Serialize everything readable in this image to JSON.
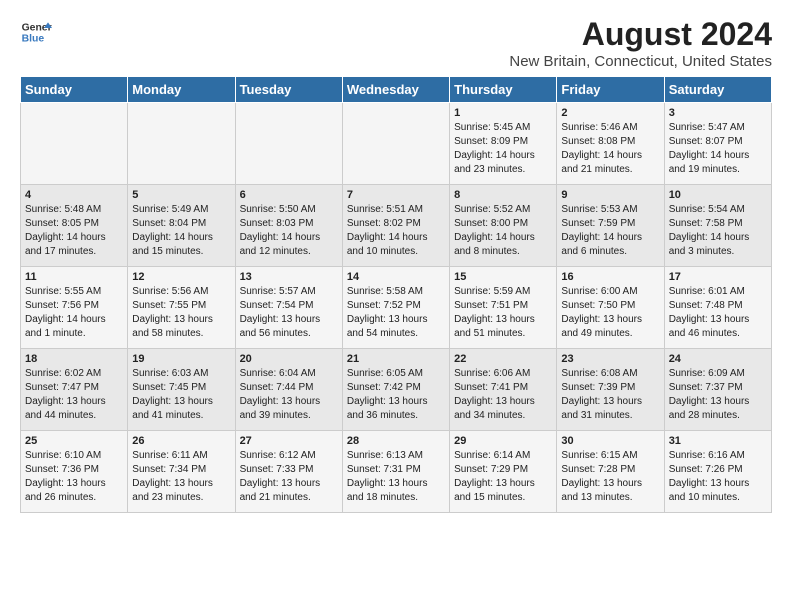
{
  "logo": {
    "line1": "General",
    "line2": "Blue"
  },
  "title": "August 2024",
  "subtitle": "New Britain, Connecticut, United States",
  "headers": [
    "Sunday",
    "Monday",
    "Tuesday",
    "Wednesday",
    "Thursday",
    "Friday",
    "Saturday"
  ],
  "weeks": [
    [
      {
        "day": "",
        "info": ""
      },
      {
        "day": "",
        "info": ""
      },
      {
        "day": "",
        "info": ""
      },
      {
        "day": "",
        "info": ""
      },
      {
        "day": "1",
        "info": "Sunrise: 5:45 AM\nSunset: 8:09 PM\nDaylight: 14 hours\nand 23 minutes."
      },
      {
        "day": "2",
        "info": "Sunrise: 5:46 AM\nSunset: 8:08 PM\nDaylight: 14 hours\nand 21 minutes."
      },
      {
        "day": "3",
        "info": "Sunrise: 5:47 AM\nSunset: 8:07 PM\nDaylight: 14 hours\nand 19 minutes."
      }
    ],
    [
      {
        "day": "4",
        "info": "Sunrise: 5:48 AM\nSunset: 8:05 PM\nDaylight: 14 hours\nand 17 minutes."
      },
      {
        "day": "5",
        "info": "Sunrise: 5:49 AM\nSunset: 8:04 PM\nDaylight: 14 hours\nand 15 minutes."
      },
      {
        "day": "6",
        "info": "Sunrise: 5:50 AM\nSunset: 8:03 PM\nDaylight: 14 hours\nand 12 minutes."
      },
      {
        "day": "7",
        "info": "Sunrise: 5:51 AM\nSunset: 8:02 PM\nDaylight: 14 hours\nand 10 minutes."
      },
      {
        "day": "8",
        "info": "Sunrise: 5:52 AM\nSunset: 8:00 PM\nDaylight: 14 hours\nand 8 minutes."
      },
      {
        "day": "9",
        "info": "Sunrise: 5:53 AM\nSunset: 7:59 PM\nDaylight: 14 hours\nand 6 minutes."
      },
      {
        "day": "10",
        "info": "Sunrise: 5:54 AM\nSunset: 7:58 PM\nDaylight: 14 hours\nand 3 minutes."
      }
    ],
    [
      {
        "day": "11",
        "info": "Sunrise: 5:55 AM\nSunset: 7:56 PM\nDaylight: 14 hours\nand 1 minute."
      },
      {
        "day": "12",
        "info": "Sunrise: 5:56 AM\nSunset: 7:55 PM\nDaylight: 13 hours\nand 58 minutes."
      },
      {
        "day": "13",
        "info": "Sunrise: 5:57 AM\nSunset: 7:54 PM\nDaylight: 13 hours\nand 56 minutes."
      },
      {
        "day": "14",
        "info": "Sunrise: 5:58 AM\nSunset: 7:52 PM\nDaylight: 13 hours\nand 54 minutes."
      },
      {
        "day": "15",
        "info": "Sunrise: 5:59 AM\nSunset: 7:51 PM\nDaylight: 13 hours\nand 51 minutes."
      },
      {
        "day": "16",
        "info": "Sunrise: 6:00 AM\nSunset: 7:50 PM\nDaylight: 13 hours\nand 49 minutes."
      },
      {
        "day": "17",
        "info": "Sunrise: 6:01 AM\nSunset: 7:48 PM\nDaylight: 13 hours\nand 46 minutes."
      }
    ],
    [
      {
        "day": "18",
        "info": "Sunrise: 6:02 AM\nSunset: 7:47 PM\nDaylight: 13 hours\nand 44 minutes."
      },
      {
        "day": "19",
        "info": "Sunrise: 6:03 AM\nSunset: 7:45 PM\nDaylight: 13 hours\nand 41 minutes."
      },
      {
        "day": "20",
        "info": "Sunrise: 6:04 AM\nSunset: 7:44 PM\nDaylight: 13 hours\nand 39 minutes."
      },
      {
        "day": "21",
        "info": "Sunrise: 6:05 AM\nSunset: 7:42 PM\nDaylight: 13 hours\nand 36 minutes."
      },
      {
        "day": "22",
        "info": "Sunrise: 6:06 AM\nSunset: 7:41 PM\nDaylight: 13 hours\nand 34 minutes."
      },
      {
        "day": "23",
        "info": "Sunrise: 6:08 AM\nSunset: 7:39 PM\nDaylight: 13 hours\nand 31 minutes."
      },
      {
        "day": "24",
        "info": "Sunrise: 6:09 AM\nSunset: 7:37 PM\nDaylight: 13 hours\nand 28 minutes."
      }
    ],
    [
      {
        "day": "25",
        "info": "Sunrise: 6:10 AM\nSunset: 7:36 PM\nDaylight: 13 hours\nand 26 minutes."
      },
      {
        "day": "26",
        "info": "Sunrise: 6:11 AM\nSunset: 7:34 PM\nDaylight: 13 hours\nand 23 minutes."
      },
      {
        "day": "27",
        "info": "Sunrise: 6:12 AM\nSunset: 7:33 PM\nDaylight: 13 hours\nand 21 minutes."
      },
      {
        "day": "28",
        "info": "Sunrise: 6:13 AM\nSunset: 7:31 PM\nDaylight: 13 hours\nand 18 minutes."
      },
      {
        "day": "29",
        "info": "Sunrise: 6:14 AM\nSunset: 7:29 PM\nDaylight: 13 hours\nand 15 minutes."
      },
      {
        "day": "30",
        "info": "Sunrise: 6:15 AM\nSunset: 7:28 PM\nDaylight: 13 hours\nand 13 minutes."
      },
      {
        "day": "31",
        "info": "Sunrise: 6:16 AM\nSunset: 7:26 PM\nDaylight: 13 hours\nand 10 minutes."
      }
    ]
  ]
}
